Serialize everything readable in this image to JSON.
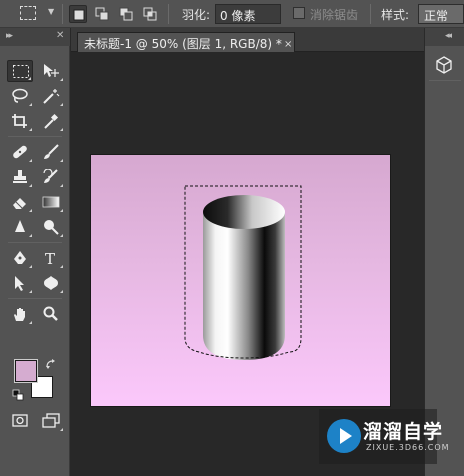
{
  "options_bar": {
    "feather_label": "羽化:",
    "feather_value": "0 像素",
    "antialias_label": "消除锯齿",
    "style_label": "样式:",
    "style_value": "正常"
  },
  "document": {
    "tab_title": "未标题-1 @ 50% (图层 1, RGB/8) *",
    "close_glyph": "×"
  },
  "tools": [
    {
      "name": "rectangular-marquee-tool",
      "active": true
    },
    {
      "name": "move-tool"
    },
    {
      "name": "lasso-tool"
    },
    {
      "name": "magic-wand-tool"
    },
    {
      "name": "crop-tool"
    },
    {
      "name": "eyedropper-tool"
    },
    {
      "name": "spot-healing-brush-tool"
    },
    {
      "name": "brush-tool"
    },
    {
      "name": "clone-stamp-tool"
    },
    {
      "name": "history-brush-tool"
    },
    {
      "name": "eraser-tool"
    },
    {
      "name": "gradient-tool"
    },
    {
      "name": "blur-tool"
    },
    {
      "name": "dodge-tool"
    },
    {
      "name": "pen-tool"
    },
    {
      "name": "type-tool",
      "glyph": "T"
    },
    {
      "name": "path-selection-tool"
    },
    {
      "name": "custom-shape-tool"
    },
    {
      "name": "hand-tool"
    },
    {
      "name": "zoom-tool"
    }
  ],
  "colors": {
    "foreground": "#d5acd0",
    "background": "#ffffff",
    "canvas_top": "#d6a8d0",
    "canvas_bottom": "#fbc8fb",
    "ui_panel": "#535353",
    "workspace": "#282828"
  },
  "watermark": {
    "title": "溜溜自学",
    "url": "ZIXUE.3D66.COM"
  }
}
